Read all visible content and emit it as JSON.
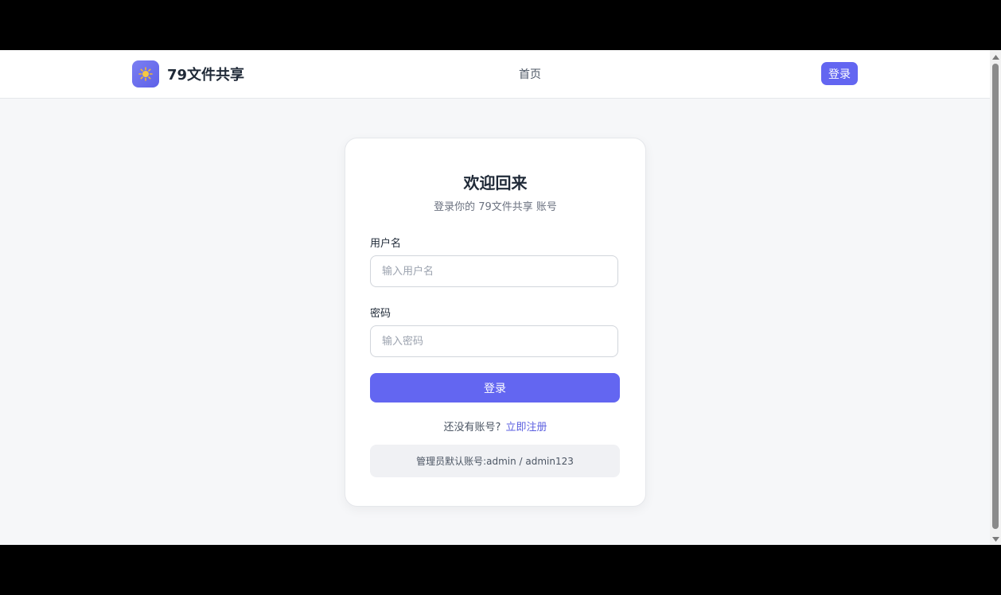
{
  "header": {
    "brand_name": "79文件共享",
    "logo_icon": "sun-icon",
    "nav_home": "首页",
    "login_button": "登录"
  },
  "login_card": {
    "title": "欢迎回来",
    "subtitle": "登录你的 79文件共享 账号",
    "username_label": "用户名",
    "username_placeholder": "输入用户名",
    "username_value": "",
    "password_label": "密码",
    "password_placeholder": "输入密码",
    "password_value": "",
    "submit_label": "登录",
    "no_account_text": "还没有账号?",
    "register_link": "立即注册",
    "admin_hint": "管理员默认账号:admin / admin123"
  },
  "colors": {
    "accent": "#6366f1",
    "page_bg": "#f6f7f9",
    "card_bg": "#ffffff"
  }
}
